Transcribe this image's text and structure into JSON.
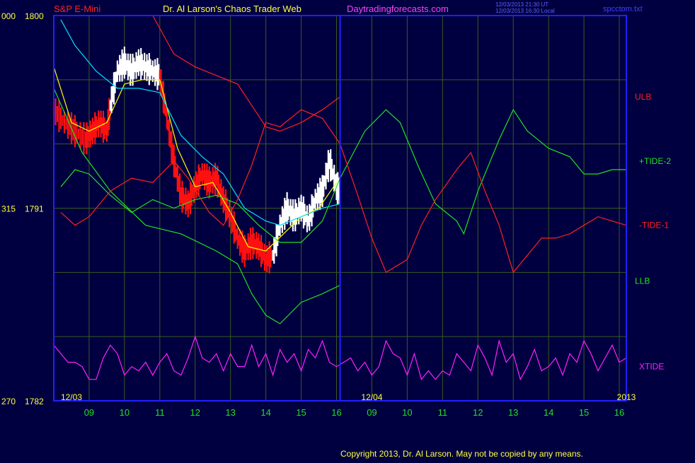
{
  "header": {
    "instrument": "S&P E-Mini",
    "author": "Dr. Al Larson's Chaos Trader Web",
    "site": "Daytradingforecasts.com",
    "stamp1": "12/03/2013 21:30 UT",
    "stamp2": "12/03/2013 16:30 Local",
    "file": "spcctom.txt"
  },
  "copyright": "Copyright 2013, Dr. Al Larson. May not be copied by any means.",
  "colors": {
    "background": "#000040",
    "frame": "#2020ff",
    "price_up": "#ffffff",
    "price_down": "#ff1010",
    "ma_fast": "#ffff00",
    "ma_slow": "#00e0ff",
    "ulb": "#ff2020",
    "llb": "#20e020",
    "tide2": "#20e020",
    "tide1": "#ff2020",
    "xtide": "#ff20ff"
  },
  "chart_data": {
    "type": "line",
    "title": "S&P E-Mini",
    "y_axis_labels": [
      {
        "prefix": "000",
        "value": "1800"
      },
      {
        "prefix": "315",
        "value": "1791"
      },
      {
        "prefix": "270",
        "value": "1782"
      }
    ],
    "ylim": [
      1782,
      1800
    ],
    "xlim": [
      8.0,
      24.2
    ],
    "hour_ticks": [
      {
        "x": 9,
        "label": "09"
      },
      {
        "x": 10,
        "label": "10"
      },
      {
        "x": 11,
        "label": "11"
      },
      {
        "x": 12,
        "label": "12"
      },
      {
        "x": 13,
        "label": "13"
      },
      {
        "x": 14,
        "label": "14"
      },
      {
        "x": 15,
        "label": "15"
      },
      {
        "x": 16,
        "label": "16"
      },
      {
        "x": 17,
        "label": "09"
      },
      {
        "x": 18,
        "label": "10"
      },
      {
        "x": 19,
        "label": "11"
      },
      {
        "x": 20,
        "label": "12"
      },
      {
        "x": 21,
        "label": "13"
      },
      {
        "x": 22,
        "label": "14"
      },
      {
        "x": 23,
        "label": "15"
      },
      {
        "x": 24,
        "label": "16"
      }
    ],
    "date_labels": [
      {
        "x": 8.5,
        "label": "12/03"
      },
      {
        "x": 17.0,
        "label": "12/04"
      },
      {
        "x": 24.2,
        "label": "2013"
      }
    ],
    "day_divider_x": 16.1,
    "price_segments": [
      {
        "color": "down",
        "points": [
          [
            8.0,
            1795.6
          ],
          [
            8.3,
            1795.0
          ],
          [
            8.6,
            1794.6
          ],
          [
            8.9,
            1794.2
          ],
          [
            9.1,
            1794.6
          ],
          [
            9.3,
            1795.0
          ],
          [
            9.5,
            1794.6
          ],
          [
            9.6,
            1795.8
          ]
        ]
      },
      {
        "color": "up",
        "points": [
          [
            9.6,
            1795.8
          ],
          [
            9.8,
            1797.4
          ],
          [
            10.0,
            1797.8
          ],
          [
            10.2,
            1797.4
          ],
          [
            10.4,
            1797.8
          ],
          [
            10.6,
            1797.6
          ],
          [
            10.8,
            1797.4
          ],
          [
            11.0,
            1797.2
          ]
        ]
      },
      {
        "color": "down",
        "points": [
          [
            11.0,
            1797.2
          ],
          [
            11.2,
            1795.2
          ],
          [
            11.4,
            1793.2
          ],
          [
            11.6,
            1791.6
          ],
          [
            11.8,
            1791.2
          ],
          [
            12.0,
            1792.0
          ],
          [
            12.2,
            1792.6
          ],
          [
            12.4,
            1792.2
          ],
          [
            12.6,
            1792.4
          ],
          [
            12.8,
            1791.4
          ],
          [
            13.0,
            1790.6
          ],
          [
            13.2,
            1789.6
          ],
          [
            13.4,
            1789.0
          ],
          [
            13.6,
            1789.4
          ],
          [
            13.8,
            1789.2
          ],
          [
            14.0,
            1788.6
          ],
          [
            14.2,
            1788.8
          ]
        ]
      },
      {
        "color": "up",
        "points": [
          [
            14.2,
            1788.8
          ],
          [
            14.4,
            1790.2
          ],
          [
            14.6,
            1791.0
          ],
          [
            14.8,
            1790.6
          ],
          [
            15.0,
            1791.0
          ],
          [
            15.2,
            1790.4
          ],
          [
            15.4,
            1791.4
          ],
          [
            15.6,
            1791.8
          ],
          [
            15.8,
            1793.2
          ],
          [
            16.0,
            1792.0
          ],
          [
            16.1,
            1791.8
          ]
        ]
      }
    ],
    "series": [
      {
        "key": "ma_fast",
        "points": [
          [
            8.0,
            1797.6
          ],
          [
            8.5,
            1795.0
          ],
          [
            9.0,
            1794.6
          ],
          [
            9.5,
            1795.0
          ],
          [
            10.0,
            1796.8
          ],
          [
            10.5,
            1797.0
          ],
          [
            11.0,
            1797.0
          ],
          [
            11.5,
            1793.8
          ],
          [
            12.0,
            1792.0
          ],
          [
            12.5,
            1792.2
          ],
          [
            13.0,
            1790.8
          ],
          [
            13.5,
            1789.2
          ],
          [
            14.0,
            1789.0
          ],
          [
            14.5,
            1789.8
          ],
          [
            15.0,
            1790.6
          ],
          [
            15.5,
            1791.0
          ],
          [
            16.0,
            1792.2
          ]
        ]
      },
      {
        "key": "ma_slow",
        "points": [
          [
            8.2,
            1799.8
          ],
          [
            8.6,
            1798.6
          ],
          [
            9.2,
            1797.4
          ],
          [
            9.8,
            1796.6
          ],
          [
            10.4,
            1796.6
          ],
          [
            11.0,
            1796.4
          ],
          [
            11.6,
            1794.4
          ],
          [
            12.2,
            1793.4
          ],
          [
            12.8,
            1792.6
          ],
          [
            13.4,
            1791.0
          ],
          [
            14.0,
            1790.4
          ],
          [
            14.4,
            1790.2
          ],
          [
            15.0,
            1790.6
          ],
          [
            15.6,
            1791.0
          ],
          [
            16.1,
            1791.2
          ]
        ]
      },
      {
        "key": "ulb",
        "points": [
          [
            10.8,
            1800.0
          ],
          [
            11.4,
            1798.2
          ],
          [
            12.0,
            1797.6
          ],
          [
            12.6,
            1797.2
          ],
          [
            13.2,
            1796.8
          ],
          [
            13.6,
            1795.8
          ],
          [
            14.0,
            1794.8
          ],
          [
            14.4,
            1794.6
          ],
          [
            15.0,
            1795.0
          ],
          [
            15.6,
            1795.6
          ],
          [
            16.1,
            1796.2
          ]
        ]
      },
      {
        "key": "llb",
        "points": [
          [
            8.0,
            1796.6
          ],
          [
            8.8,
            1793.6
          ],
          [
            9.6,
            1791.8
          ],
          [
            10.6,
            1790.2
          ],
          [
            11.6,
            1789.8
          ],
          [
            12.6,
            1789.0
          ],
          [
            13.2,
            1788.4
          ],
          [
            13.6,
            1787.0
          ],
          [
            14.0,
            1786.0
          ],
          [
            14.4,
            1785.6
          ],
          [
            15.0,
            1786.6
          ],
          [
            15.6,
            1787.0
          ],
          [
            16.1,
            1787.4
          ]
        ]
      },
      {
        "key": "tide2",
        "points": [
          [
            8.2,
            1792.0
          ],
          [
            8.6,
            1792.8
          ],
          [
            9.0,
            1792.6
          ],
          [
            9.6,
            1791.6
          ],
          [
            10.2,
            1790.8
          ],
          [
            10.8,
            1791.4
          ],
          [
            11.4,
            1791.0
          ],
          [
            12.0,
            1791.4
          ],
          [
            12.6,
            1791.6
          ],
          [
            13.2,
            1791.2
          ],
          [
            13.8,
            1790.2
          ],
          [
            14.4,
            1789.4
          ],
          [
            15.0,
            1789.4
          ],
          [
            15.6,
            1790.4
          ],
          [
            16.1,
            1792.4
          ],
          [
            16.8,
            1794.6
          ],
          [
            17.4,
            1795.6
          ],
          [
            17.8,
            1795.0
          ],
          [
            18.3,
            1793.0
          ],
          [
            18.8,
            1791.2
          ],
          [
            19.4,
            1790.4
          ],
          [
            19.6,
            1789.8
          ],
          [
            20.0,
            1791.8
          ],
          [
            20.6,
            1794.2
          ],
          [
            21.0,
            1795.6
          ],
          [
            21.4,
            1794.6
          ],
          [
            22.0,
            1793.8
          ],
          [
            22.6,
            1793.4
          ],
          [
            23.0,
            1792.6
          ],
          [
            23.4,
            1792.6
          ],
          [
            23.8,
            1792.8
          ],
          [
            24.2,
            1792.8
          ]
        ]
      },
      {
        "key": "tide1",
        "points": [
          [
            8.2,
            1790.8
          ],
          [
            8.6,
            1790.2
          ],
          [
            9.0,
            1790.6
          ],
          [
            9.6,
            1791.8
          ],
          [
            10.2,
            1792.4
          ],
          [
            10.8,
            1792.2
          ],
          [
            11.4,
            1793.2
          ],
          [
            11.8,
            1792.4
          ],
          [
            12.4,
            1790.8
          ],
          [
            12.8,
            1790.2
          ],
          [
            13.2,
            1791.4
          ],
          [
            13.6,
            1793.0
          ],
          [
            14.0,
            1795.0
          ],
          [
            14.4,
            1794.8
          ],
          [
            15.0,
            1795.6
          ],
          [
            15.6,
            1795.2
          ],
          [
            16.1,
            1794.0
          ],
          [
            16.6,
            1791.6
          ],
          [
            17.0,
            1789.6
          ],
          [
            17.4,
            1788.0
          ],
          [
            18.0,
            1788.6
          ],
          [
            18.4,
            1790.2
          ],
          [
            18.8,
            1791.4
          ],
          [
            19.4,
            1792.8
          ],
          [
            19.8,
            1793.6
          ],
          [
            20.2,
            1791.8
          ],
          [
            20.6,
            1790.2
          ],
          [
            21.0,
            1788.0
          ],
          [
            21.4,
            1788.8
          ],
          [
            21.8,
            1789.6
          ],
          [
            22.2,
            1789.6
          ],
          [
            22.6,
            1789.8
          ],
          [
            23.0,
            1790.2
          ],
          [
            23.4,
            1790.6
          ],
          [
            23.8,
            1790.4
          ],
          [
            24.2,
            1790.2
          ]
        ]
      },
      {
        "key": "xtide",
        "points": [
          [
            8.0,
            1784.6
          ],
          [
            8.2,
            1784.2
          ],
          [
            8.4,
            1783.8
          ],
          [
            8.6,
            1783.8
          ],
          [
            8.8,
            1783.6
          ],
          [
            9.0,
            1783.0
          ],
          [
            9.2,
            1783.0
          ],
          [
            9.4,
            1784.0
          ],
          [
            9.6,
            1784.6
          ],
          [
            9.8,
            1784.2
          ],
          [
            10.0,
            1783.2
          ],
          [
            10.2,
            1783.6
          ],
          [
            10.4,
            1783.4
          ],
          [
            10.6,
            1783.8
          ],
          [
            10.8,
            1783.2
          ],
          [
            11.0,
            1783.8
          ],
          [
            11.2,
            1784.2
          ],
          [
            11.4,
            1783.4
          ],
          [
            11.6,
            1783.2
          ],
          [
            11.8,
            1784.0
          ],
          [
            12.0,
            1785.0
          ],
          [
            12.2,
            1784.0
          ],
          [
            12.4,
            1783.8
          ],
          [
            12.6,
            1784.2
          ],
          [
            12.8,
            1783.4
          ],
          [
            13.0,
            1784.2
          ],
          [
            13.2,
            1783.6
          ],
          [
            13.4,
            1783.6
          ],
          [
            13.6,
            1784.6
          ],
          [
            13.8,
            1783.6
          ],
          [
            14.0,
            1784.2
          ],
          [
            14.2,
            1783.2
          ],
          [
            14.4,
            1784.4
          ],
          [
            14.6,
            1783.8
          ],
          [
            14.8,
            1784.2
          ],
          [
            15.0,
            1783.4
          ],
          [
            15.2,
            1784.4
          ],
          [
            15.4,
            1784.0
          ],
          [
            15.6,
            1784.8
          ],
          [
            15.8,
            1783.8
          ],
          [
            16.0,
            1783.6
          ],
          [
            16.2,
            1783.8
          ],
          [
            16.4,
            1784.0
          ],
          [
            16.6,
            1783.4
          ],
          [
            16.8,
            1783.8
          ],
          [
            17.0,
            1783.2
          ],
          [
            17.2,
            1783.6
          ],
          [
            17.4,
            1784.8
          ],
          [
            17.6,
            1784.2
          ],
          [
            17.8,
            1784.0
          ],
          [
            18.0,
            1783.2
          ],
          [
            18.2,
            1784.2
          ],
          [
            18.4,
            1783.0
          ],
          [
            18.6,
            1783.4
          ],
          [
            18.8,
            1783.0
          ],
          [
            19.0,
            1783.4
          ],
          [
            19.2,
            1783.2
          ],
          [
            19.4,
            1784.2
          ],
          [
            19.6,
            1783.8
          ],
          [
            19.8,
            1783.4
          ],
          [
            20.0,
            1784.6
          ],
          [
            20.2,
            1784.0
          ],
          [
            20.4,
            1783.2
          ],
          [
            20.6,
            1784.8
          ],
          [
            20.8,
            1783.8
          ],
          [
            21.0,
            1784.2
          ],
          [
            21.2,
            1783.0
          ],
          [
            21.4,
            1783.6
          ],
          [
            21.6,
            1784.4
          ],
          [
            21.8,
            1783.4
          ],
          [
            22.0,
            1783.6
          ],
          [
            22.2,
            1784.0
          ],
          [
            22.4,
            1783.2
          ],
          [
            22.6,
            1784.2
          ],
          [
            22.8,
            1783.8
          ],
          [
            23.0,
            1784.8
          ],
          [
            23.2,
            1784.2
          ],
          [
            23.4,
            1783.4
          ],
          [
            23.6,
            1784.0
          ],
          [
            23.8,
            1784.6
          ],
          [
            24.0,
            1783.8
          ],
          [
            24.2,
            1784.0
          ]
        ]
      }
    ],
    "series_labels": [
      {
        "key": "ulb",
        "text": "ULB",
        "y": 1796.2
      },
      {
        "key": "tide2",
        "text": "+TIDE-2",
        "y": 1793.2
      },
      {
        "key": "tide1",
        "text": "-TIDE-1",
        "y": 1790.2
      },
      {
        "key": "llb",
        "text": "LLB",
        "y": 1787.6
      },
      {
        "key": "xtide",
        "text": "XTIDE",
        "y": 1783.6
      }
    ]
  }
}
